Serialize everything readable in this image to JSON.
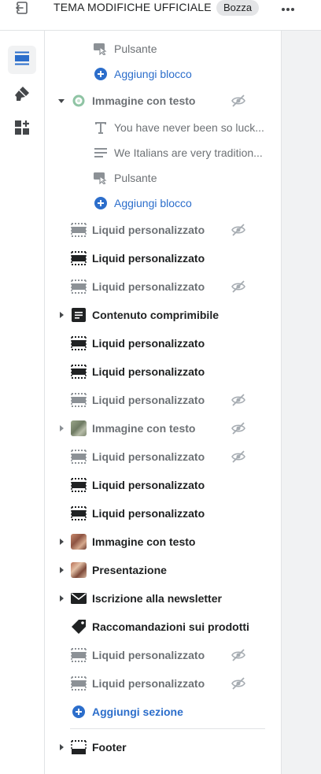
{
  "header": {
    "theme_title": "TEMA MODIFICHE UFFICIALE",
    "badge": "Bozza"
  },
  "rail": {
    "items": [
      "sections-icon",
      "theme-settings-brush-icon",
      "app-blocks-icon"
    ]
  },
  "colors": {
    "accent_blue": "#2c6ecb",
    "text_dark": "#202223",
    "text_dim": "#6d7175",
    "rail_active_bg": "#f1f2f3",
    "preview_bg": "#f1f2f3"
  },
  "tree": {
    "pulsante_1": "Pulsante",
    "add_block_1": "Aggiungi blocco",
    "image_text_expanded": "Immagine con testo",
    "text_block": "You have never been so luck...",
    "paragraph_block": "We Italians are very tradition...",
    "pulsante_2": "Pulsante",
    "add_block_2": "Aggiungi blocco",
    "liquid_1": "Liquid personalizzato",
    "liquid_2": "Liquid personalizzato",
    "liquid_3": "Liquid personalizzato",
    "collapsible": "Contenuto comprimibile",
    "liquid_4": "Liquid personalizzato",
    "liquid_5": "Liquid personalizzato",
    "liquid_6": "Liquid personalizzato",
    "image_text_2": "Immagine con testo",
    "liquid_7": "Liquid personalizzato",
    "liquid_8": "Liquid personalizzato",
    "liquid_9": "Liquid personalizzato",
    "image_text_3": "Immagine con testo",
    "presentation": "Presentazione",
    "newsletter": "Iscrizione alla newsletter",
    "recommendations": "Raccomandazioni sui prodotti",
    "liquid_10": "Liquid personalizzato",
    "liquid_11": "Liquid personalizzato",
    "add_section": "Aggiungi sezione",
    "footer": "Footer"
  }
}
